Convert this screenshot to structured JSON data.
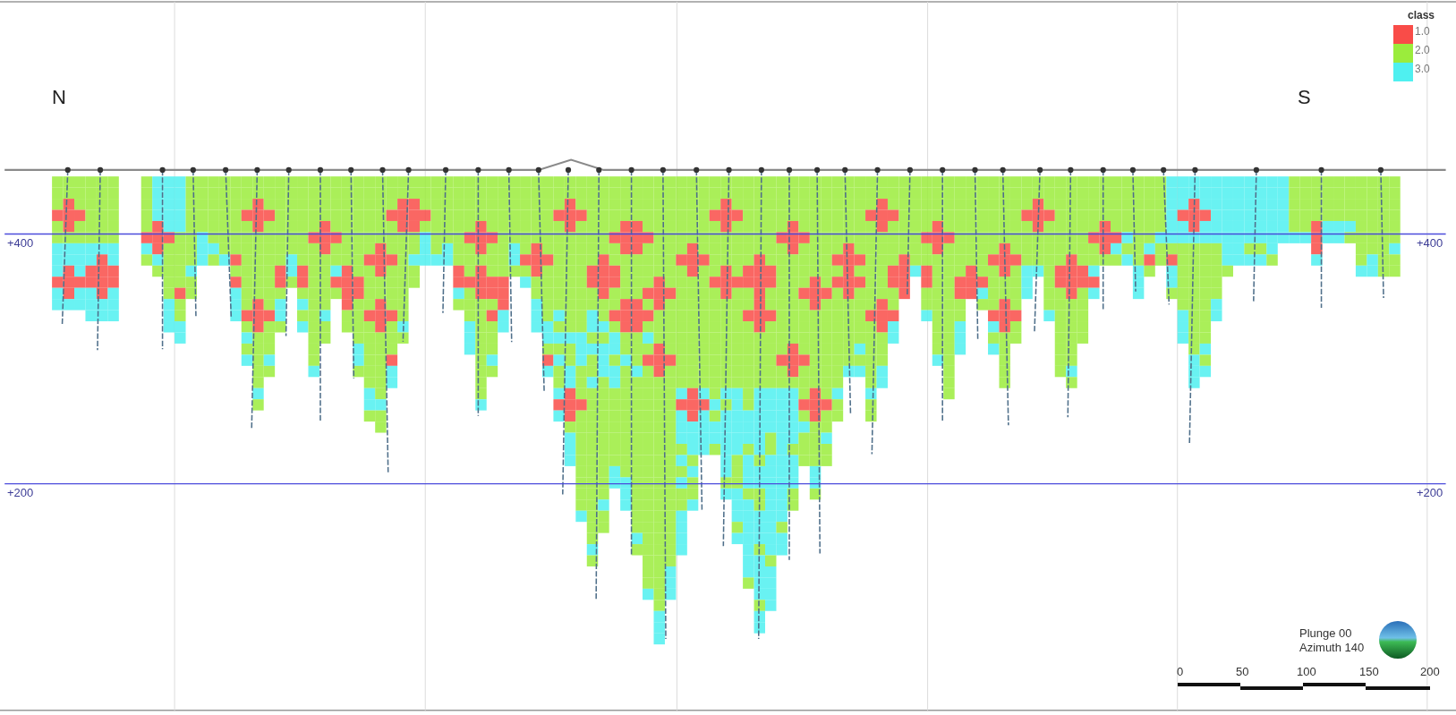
{
  "viewport": {
    "direction_labels": {
      "left": "N",
      "right": "S"
    },
    "elevation_lines": [
      {
        "left_label": "+400",
        "right_label": "+400"
      },
      {
        "left_label": "+200",
        "right_label": "+200"
      }
    ],
    "legend": {
      "title": "class",
      "items": [
        {
          "label": "1.0",
          "color": "#f94c48"
        },
        {
          "label": "2.0",
          "color": "#9bec3c"
        },
        {
          "label": "3.0",
          "color": "#4ff0f0"
        }
      ]
    },
    "orientation": {
      "plunge": "Plunge 00",
      "azimuth": "Azimuth 140"
    },
    "scale_bar": {
      "ticks": [
        "0",
        "50",
        "100",
        "150",
        "200"
      ]
    }
  }
}
